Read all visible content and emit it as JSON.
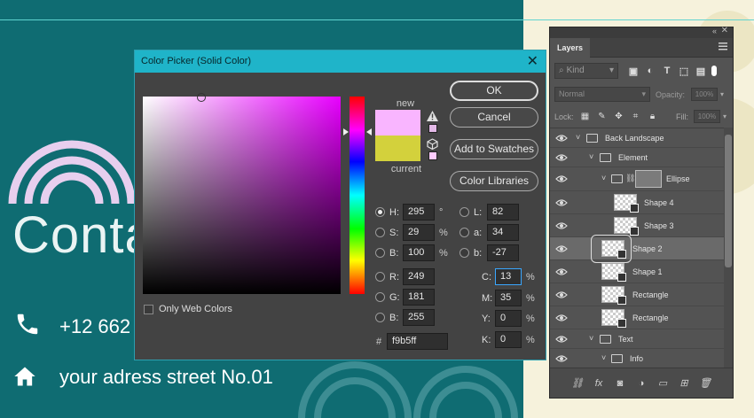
{
  "canvas": {
    "contact_title": "Conta",
    "phone": "+12 662",
    "address": "your adress street No.01"
  },
  "color_picker": {
    "title": "Color Picker (Solid Color)",
    "new_label": "new",
    "current_label": "current",
    "new_color": "#f9b5ff",
    "current_color": "#d3d13c",
    "buttons": {
      "ok": "OK",
      "cancel": "Cancel",
      "add_to_swatches": "Add to Swatches",
      "color_libraries": "Color Libraries"
    },
    "only_web_colors": "Only Web Colors",
    "hsb": {
      "h_label": "H:",
      "h_value": "295",
      "h_unit": "°",
      "s_label": "S:",
      "s_value": "29",
      "s_unit": "%",
      "b_label": "B:",
      "b_value": "100",
      "b_unit": "%"
    },
    "rgb": {
      "r_label": "R:",
      "r_value": "249",
      "g_label": "G:",
      "g_value": "181",
      "b_label": "B:",
      "b_value": "255"
    },
    "lab": {
      "l_label": "L:",
      "l_value": "82",
      "a_label": "a:",
      "a_value": "34",
      "b_label": "b:",
      "b_value": "-27"
    },
    "cmyk": {
      "c_label": "C:",
      "c_value": "13",
      "c_unit": "%",
      "m_label": "M:",
      "m_value": "35",
      "m_unit": "%",
      "y_label": "Y:",
      "y_value": "0",
      "y_unit": "%",
      "k_label": "K:",
      "k_value": "0",
      "k_unit": "%"
    },
    "hex_label": "#",
    "hex": "f9b5ff"
  },
  "layers_panel": {
    "tab": "Layers",
    "filter_kind": "Kind",
    "blend_mode": "Normal",
    "opacity_label": "Opacity:",
    "opacity_value": "100%",
    "lock_label": "Lock:",
    "fill_label": "Fill:",
    "fill_value": "100%",
    "layers": [
      {
        "name": "Back Landscape"
      },
      {
        "name": "Element"
      },
      {
        "name": "Ellipse"
      },
      {
        "name": "Shape 4"
      },
      {
        "name": "Shape 3"
      },
      {
        "name": "Shape 2"
      },
      {
        "name": "Shape 1"
      },
      {
        "name": "Rectangle"
      },
      {
        "name": "Rectangle"
      },
      {
        "name": "Text"
      },
      {
        "name": "Info"
      }
    ]
  }
}
